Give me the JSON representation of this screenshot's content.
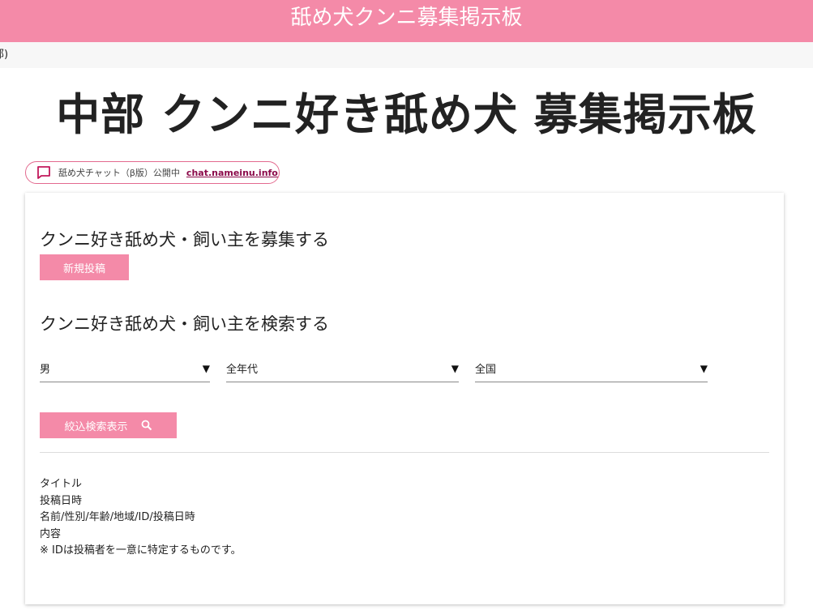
{
  "header": {
    "site_title": "舐め犬クンニ募集掲示板"
  },
  "breadcrumb": {
    "text": "部)"
  },
  "page": {
    "title": "中部 クンニ好き舐め犬 募集掲示板"
  },
  "chat_banner": {
    "icon": "chat-bubble-icon",
    "text": "舐め犬チャット（β版）公開中",
    "link_text": "chat.nameinu.info"
  },
  "recruit": {
    "heading": "クンニ好き舐め犬・飼い主を募集する",
    "new_post_label": "新規投稿"
  },
  "search": {
    "heading": "クンニ好き舐め犬・飼い主を検索する",
    "gender_value": "男",
    "age_value": "全年代",
    "region_value": "全国",
    "arrow": "▼",
    "submit_label": "絞込検索表示",
    "submit_icon": "search-icon"
  },
  "legend": {
    "line1": "タイトル",
    "line2": "投稿日時",
    "line3": "名前/性別/年齢/地域/ID/投稿日時",
    "line4": "内容",
    "line5": "※ IDは投稿者を一意に特定するものです。"
  },
  "colors": {
    "accent": "#f48aa8",
    "link": "#8b0a4a"
  }
}
